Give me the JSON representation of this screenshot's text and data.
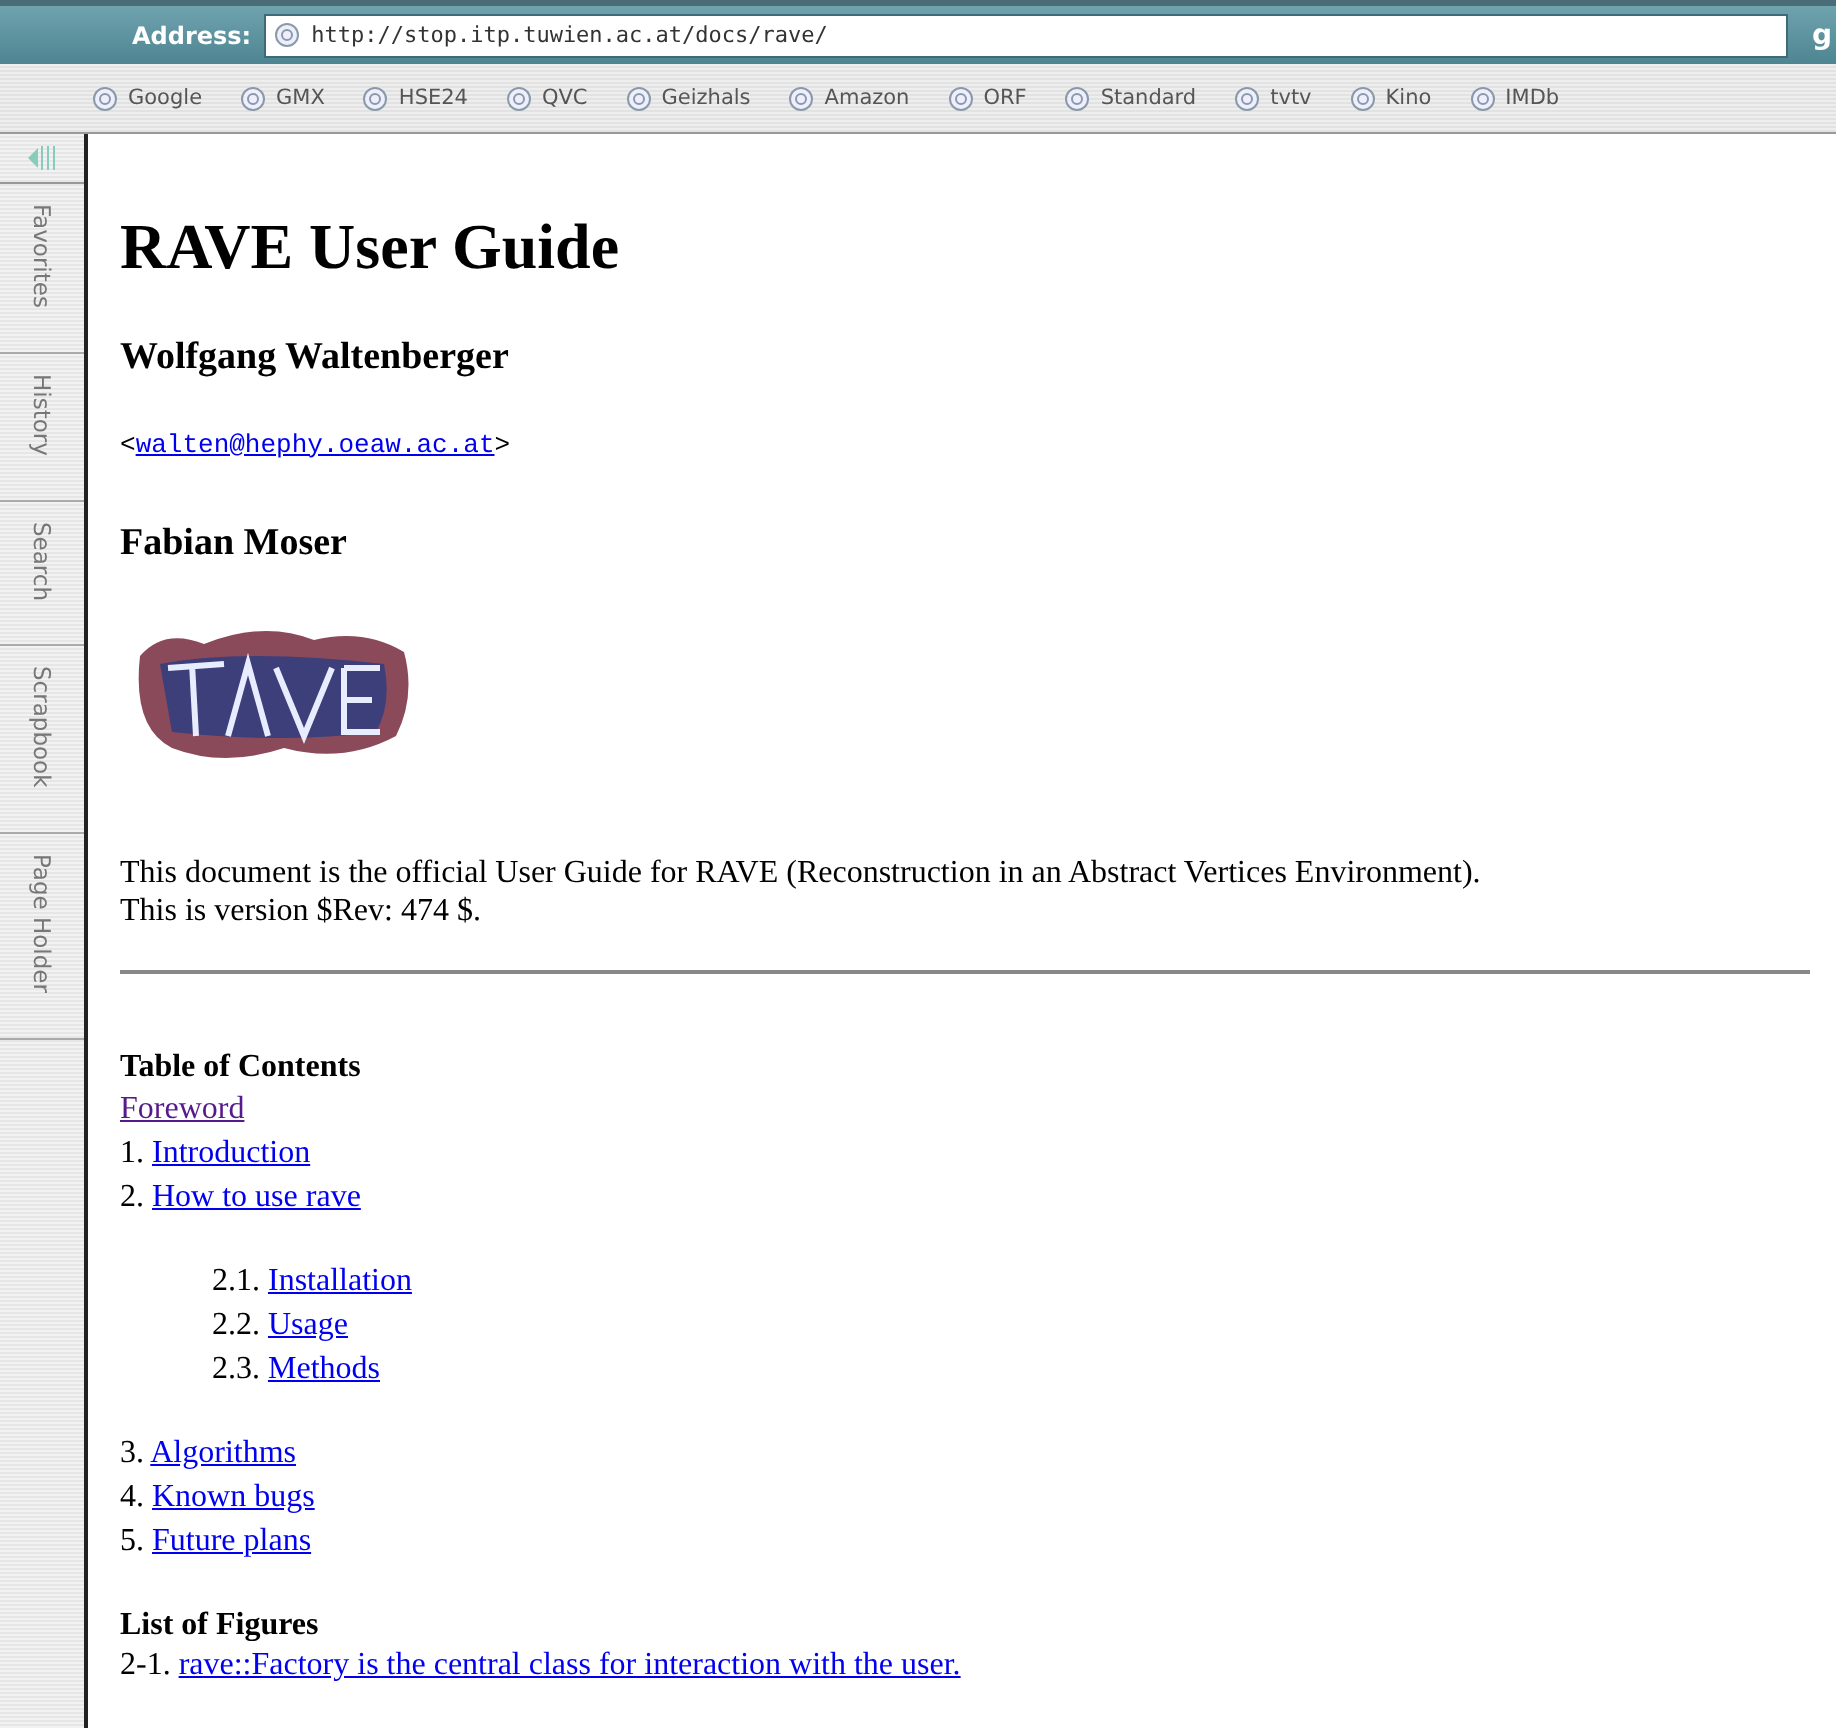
{
  "toolbar": {
    "address_label": "Address:",
    "url": "http://stop.itp.tuwien.ac.at/docs/rave/",
    "go_button": "g"
  },
  "bookmarks": [
    "Google",
    "GMX",
    "HSE24",
    "QVC",
    "Geizhals",
    "Amazon",
    "ORF",
    "Standard",
    "tvtv",
    "Kino",
    "IMDb"
  ],
  "sidebar_tabs": [
    {
      "label": "Favorites",
      "selected": false
    },
    {
      "label": "History",
      "selected": false
    },
    {
      "label": "Search",
      "selected": false
    },
    {
      "label": "Scrapbook",
      "selected": false
    },
    {
      "label": "Page Holder",
      "selected": false
    }
  ],
  "page": {
    "title": "RAVE User Guide",
    "authors": [
      {
        "name": "Wolfgang Waltenberger",
        "email_open": "<",
        "email": "walten@hephy.oeaw.ac.at",
        "email_close": ">"
      },
      {
        "name": "Fabian Moser"
      }
    ],
    "intro": [
      "This document is the official User Guide for RAVE (Reconstruction in an Abstract Vertices Environment).",
      "This is version $Rev: 474 $."
    ],
    "toc_heading": "Table of Contents",
    "toc": [
      {
        "label": "Foreword",
        "visited": true
      },
      {
        "number": "1.",
        "label": "Introduction",
        "visited": false
      },
      {
        "number": "2.",
        "label": "How to use rave",
        "visited": false,
        "children": [
          {
            "number": "2.1.",
            "label": "Installation",
            "visited": false
          },
          {
            "number": "2.2.",
            "label": "Usage",
            "visited": false
          },
          {
            "number": "2.3.",
            "label": "Methods",
            "visited": false
          }
        ]
      },
      {
        "number": "3.",
        "label": "Algorithms",
        "visited": false
      },
      {
        "number": "4.",
        "label": "Known bugs",
        "visited": false
      },
      {
        "number": "5.",
        "label": "Future plans",
        "visited": false
      }
    ],
    "figures_heading": "List of Figures",
    "figures": [
      {
        "number": "2-1.",
        "label": "rave::Factory is the central class for interaction with the user.",
        "visited": false
      }
    ]
  }
}
